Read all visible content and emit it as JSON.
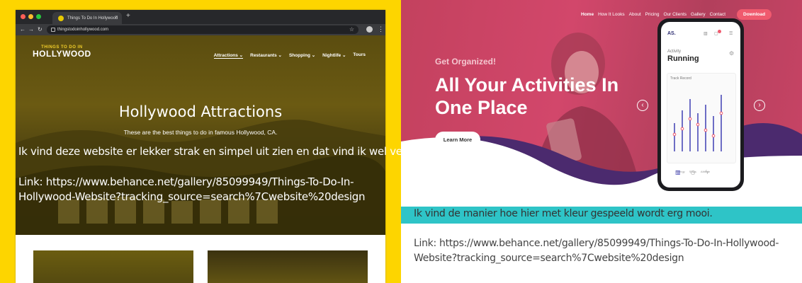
{
  "left": {
    "browser": {
      "tab_title": "Things To Do In Hollywood",
      "url": "thingstodoinhollywood.com",
      "new_tab": "+",
      "tab_close": "×"
    },
    "site": {
      "logo_small": "THINGS TO DO IN",
      "logo_big": "HOLLYWOOD",
      "nav": [
        "Attractions ⌄",
        "Restaurants ⌄",
        "Shopping ⌄",
        "Nightlife ⌄",
        "Tours"
      ],
      "hero_title": "Hollywood Attractions",
      "hero_subtitle": "These are the best things to do in famous Hollywood, CA."
    },
    "comment": "Ik vind deze website er lekker strak en simpel uit zien en dat vind ik wel vet.",
    "link": "Link: https://www.behance.net/gallery/85099949/Things-To-Do-In-Hollywood-Website?tracking_source=search%7Cwebsite%20design"
  },
  "right": {
    "nav": [
      "Home",
      "How It Looks",
      "About",
      "Pricing",
      "Our Clients",
      "Gallery",
      "Contact"
    ],
    "download": "Download",
    "get_organized": "Get Organized!",
    "title": "All Your Activities In One Place",
    "learn_more": "Learn More",
    "app": {
      "logo": "AS.",
      "activity_label": "Activity",
      "activity_value": "Running",
      "track_label": "Track Record",
      "legend": [
        "Energy",
        "Steps",
        "Altitude"
      ]
    },
    "comment": "Ik vind de manier hoe hier met kleur gespeeld wordt erg mooi.",
    "link": "Link: https://www.behance.net/gallery/85099949/Things-To-Do-In-Hollywood-Website?tracking_source=search%7Cwebsite%20design"
  },
  "colors": {
    "yellow_bg": "#fdd500",
    "pink_hero": "#c84465",
    "teal_bar": "#2ec4c7",
    "download_btn": "#f05a6e"
  }
}
